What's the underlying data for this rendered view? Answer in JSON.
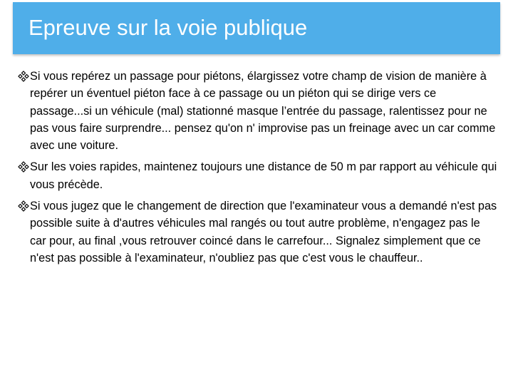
{
  "slide": {
    "title": "Epreuve sur la voie publique",
    "accent_color": "#4faee9",
    "bullet_icon": "diamond-cluster-icon",
    "bullets": [
      {
        "text": "Si vous repérez un passage pour piétons, élargissez votre champ de vision de manière à repérer un éventuel piéton face à ce passage ou un piéton qui se dirige vers ce passage...si un véhicule (mal) stationné masque l’entrée du passage, ralentissez pour ne pas vous faire surprendre...  pensez qu'on n' improvise pas un freinage avec un car comme avec une voiture."
      },
      {
        "text": "Sur les voies rapides, maintenez toujours une distance de 50 m par rapport au véhicule qui vous précède."
      },
      {
        "text": "Si vous jugez que le changement de direction que l'examinateur vous a demandé n'est pas possible suite à d'autres véhicules mal rangés ou tout autre problème, n'engagez pas le car pour, au final ,vous retrouver coincé dans le carrefour... Signalez simplement que ce n'est pas possible à l'examinateur, n'oubliez pas que c'est vous le chauffeur.."
      }
    ]
  }
}
